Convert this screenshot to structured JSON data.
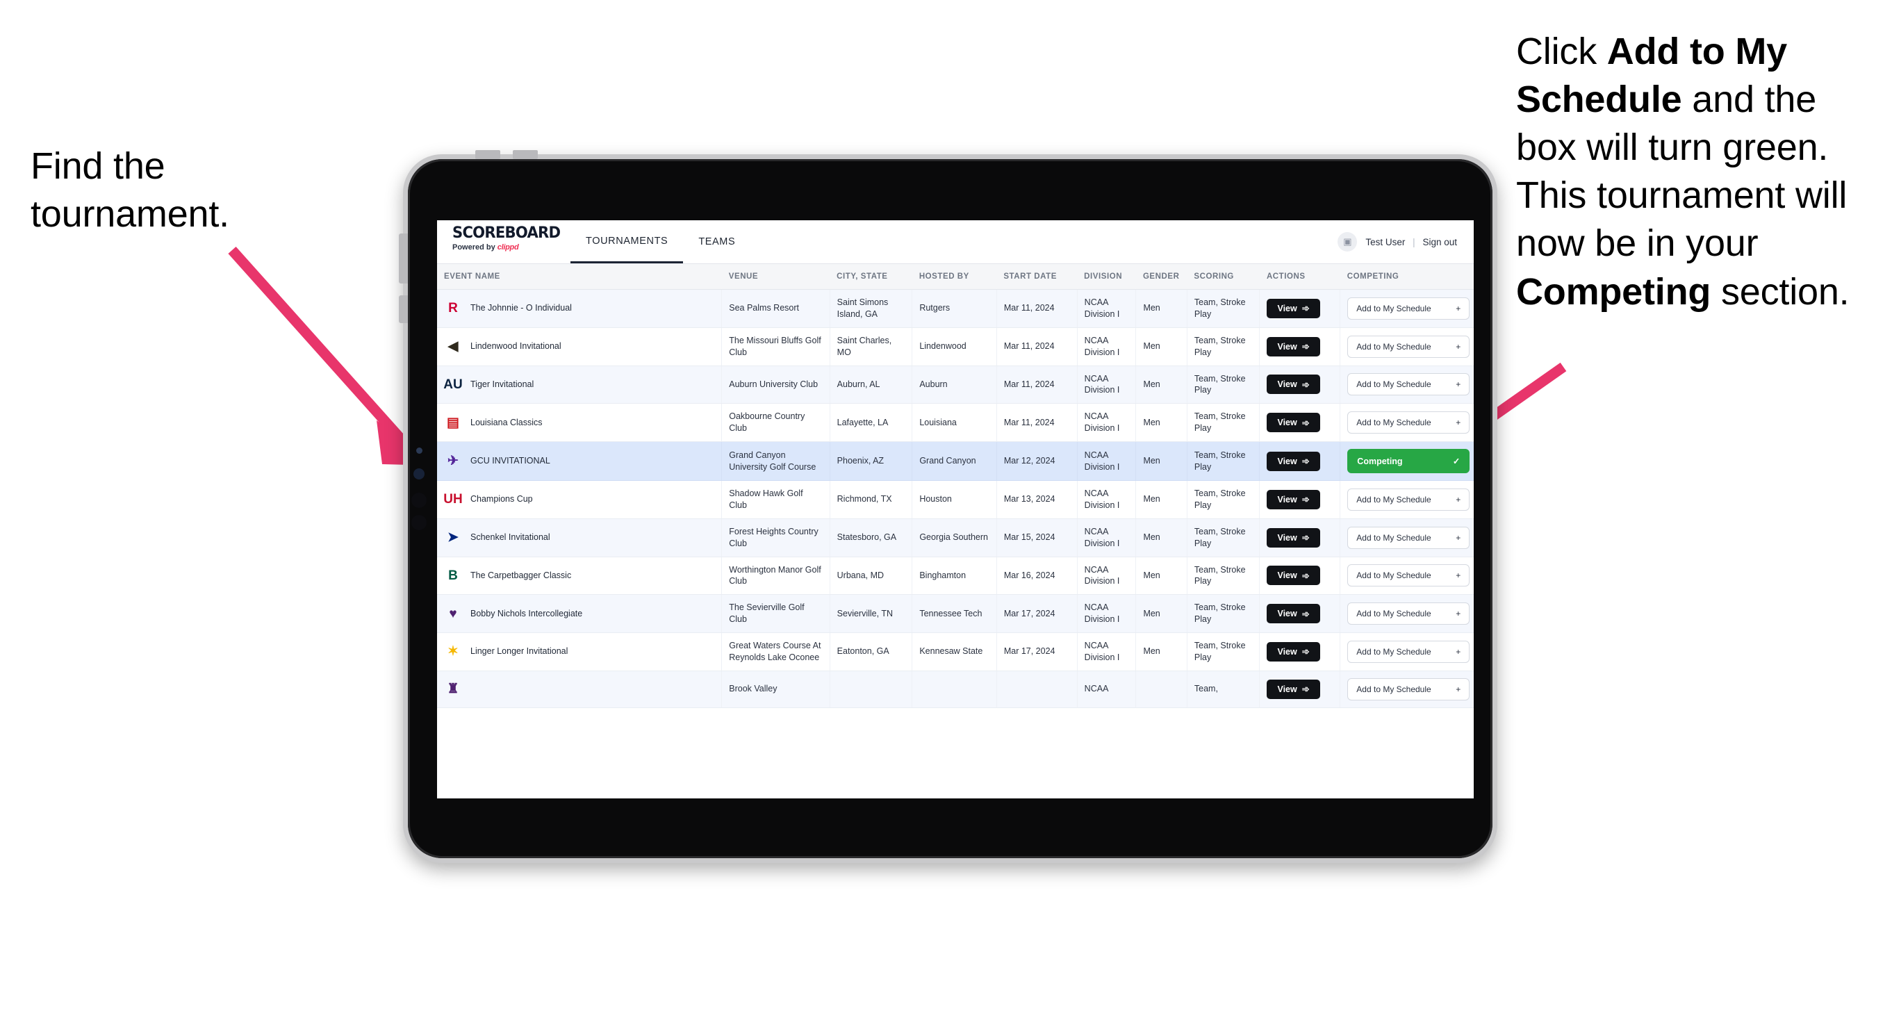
{
  "annotations": {
    "left": "Find the tournament.",
    "right_parts": [
      {
        "t": "Click ",
        "b": false
      },
      {
        "t": "Add to My Schedule",
        "b": true
      },
      {
        "t": " and the box will turn green. This tournament will now be in your ",
        "b": false
      },
      {
        "t": "Competing",
        "b": true
      },
      {
        "t": " section.",
        "b": false
      }
    ],
    "arrow_color": "#e8356b"
  },
  "app": {
    "brand": {
      "title": "SCOREBOARD",
      "powered_prefix": "Powered by ",
      "powered_brand": "clippd"
    },
    "nav": [
      {
        "label": "TOURNAMENTS",
        "active": true
      },
      {
        "label": "TEAMS",
        "active": false
      }
    ],
    "user": {
      "avatar_icon": "user-tile-icon",
      "name": "Test User",
      "separator": "|",
      "signout": "Sign out"
    },
    "table": {
      "columns": [
        "EVENT NAME",
        "VENUE",
        "CITY, STATE",
        "HOSTED BY",
        "START DATE",
        "DIVISION",
        "GENDER",
        "SCORING",
        "ACTIONS",
        "COMPETING"
      ],
      "view_label": "View",
      "view_icon": "arrow-right-circle-icon",
      "add_label": "Add to My Schedule",
      "add_icon": "plus-icon",
      "competing_label": "Competing",
      "competing_icon": "check-icon",
      "competing_color": "#27a745",
      "rows": [
        {
          "logo": "R",
          "logo_color": "#cc0033",
          "event": "The Johnnie - O Individual",
          "venue": "Sea Palms Resort",
          "city": "Saint Simons Island, GA",
          "host": "Rutgers",
          "date": "Mar 11, 2024",
          "division": "NCAA Division I",
          "gender": "Men",
          "scoring": "Team, Stroke Play",
          "competing": false
        },
        {
          "logo": "◀",
          "logo_color": "#2f2a1d",
          "event": "Lindenwood Invitational",
          "venue": "The Missouri Bluffs Golf Club",
          "city": "Saint Charles, MO",
          "host": "Lindenwood",
          "date": "Mar 11, 2024",
          "division": "NCAA Division I",
          "gender": "Men",
          "scoring": "Team, Stroke Play",
          "competing": false
        },
        {
          "logo": "AU",
          "logo_color": "#0c2340",
          "event": "Tiger Invitational",
          "venue": "Auburn University Club",
          "city": "Auburn, AL",
          "host": "Auburn",
          "date": "Mar 11, 2024",
          "division": "NCAA Division I",
          "gender": "Men",
          "scoring": "Team, Stroke Play",
          "competing": false
        },
        {
          "logo": "▤",
          "logo_color": "#ce181e",
          "event": "Louisiana Classics",
          "venue": "Oakbourne Country Club",
          "city": "Lafayette, LA",
          "host": "Louisiana",
          "date": "Mar 11, 2024",
          "division": "NCAA Division I",
          "gender": "Men",
          "scoring": "Team, Stroke Play",
          "competing": false
        },
        {
          "logo": "✈",
          "logo_color": "#522398",
          "event": "GCU INVITATIONAL",
          "venue": "Grand Canyon University Golf Course",
          "city": "Phoenix, AZ",
          "host": "Grand Canyon",
          "date": "Mar 12, 2024",
          "division": "NCAA Division I",
          "gender": "Men",
          "scoring": "Team, Stroke Play",
          "competing": true
        },
        {
          "logo": "UH",
          "logo_color": "#c8102e",
          "event": "Champions Cup",
          "venue": "Shadow Hawk Golf Club",
          "city": "Richmond, TX",
          "host": "Houston",
          "date": "Mar 13, 2024",
          "division": "NCAA Division I",
          "gender": "Men",
          "scoring": "Team, Stroke Play",
          "competing": false
        },
        {
          "logo": "➤",
          "logo_color": "#01257d",
          "event": "Schenkel Invitational",
          "venue": "Forest Heights Country Club",
          "city": "Statesboro, GA",
          "host": "Georgia Southern",
          "date": "Mar 15, 2024",
          "division": "NCAA Division I",
          "gender": "Men",
          "scoring": "Team, Stroke Play",
          "competing": false
        },
        {
          "logo": "B",
          "logo_color": "#005a43",
          "event": "The Carpetbagger Classic",
          "venue": "Worthington Manor Golf Club",
          "city": "Urbana, MD",
          "host": "Binghamton",
          "date": "Mar 16, 2024",
          "division": "NCAA Division I",
          "gender": "Men",
          "scoring": "Team, Stroke Play",
          "competing": false
        },
        {
          "logo": "♥",
          "logo_color": "#4f2170",
          "event": "Bobby Nichols Intercollegiate",
          "venue": "The Sevierville Golf Club",
          "city": "Sevierville, TN",
          "host": "Tennessee Tech",
          "date": "Mar 17, 2024",
          "division": "NCAA Division I",
          "gender": "Men",
          "scoring": "Team, Stroke Play",
          "competing": false
        },
        {
          "logo": "✶",
          "logo_color": "#f5b700",
          "event": "Linger Longer Invitational",
          "venue": "Great Waters Course At Reynolds Lake Oconee",
          "city": "Eatonton, GA",
          "host": "Kennesaw State",
          "date": "Mar 17, 2024",
          "division": "NCAA Division I",
          "gender": "Men",
          "scoring": "Team, Stroke Play",
          "competing": false
        },
        {
          "logo": "♜",
          "logo_color": "#4f2170",
          "event": "",
          "venue": "Brook Valley",
          "city": "",
          "host": "",
          "date": "",
          "division": "NCAA",
          "gender": "",
          "scoring": "Team,",
          "competing": false
        }
      ]
    }
  }
}
